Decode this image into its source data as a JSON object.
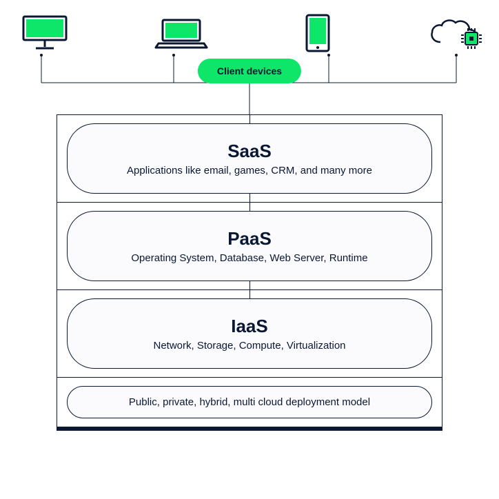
{
  "clientLabel": "Client devices",
  "layers": [
    {
      "title": "SaaS",
      "sub": "Applications like email, games, CRM, and many more"
    },
    {
      "title": "PaaS",
      "sub": "Operating System, Database, Web Server, Runtime"
    },
    {
      "title": "IaaS",
      "sub": "Network, Storage, Compute, Virtualization"
    }
  ],
  "deployment": "Public, private, hybrid, multi cloud deployment model",
  "devices": [
    "desktop",
    "laptop",
    "phone",
    "cloud-chip"
  ]
}
